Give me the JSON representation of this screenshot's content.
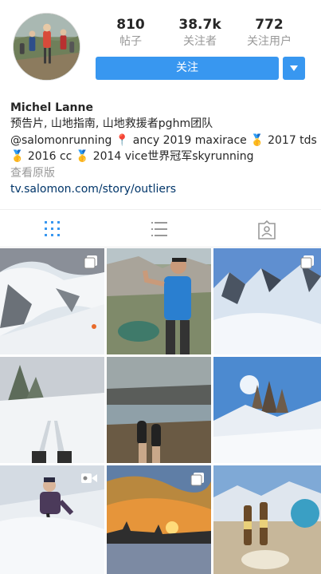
{
  "profile": {
    "username": "Michel Lanne",
    "avatar_icon": "profile-photo-trail-runners",
    "stats": [
      {
        "value": "810",
        "label": "帖子"
      },
      {
        "value": "38.7k",
        "label": "关注者"
      },
      {
        "value": "772",
        "label": "关注用户"
      }
    ],
    "follow_label": "关注",
    "dropdown_icon": "triangle-down-icon",
    "bio_lines": [
      "预告片, 山地指南, 山地救援者pghm团队",
      "@salomonrunning 📍 ancy 2019 maxirace 🥇 2017 tds",
      "🥇 2016 cc 🥇 2014 vice世界冠军skyrunning"
    ],
    "translate_label": "查看原版",
    "website": "tv.salomon.com/story/outliers"
  },
  "tabs": [
    {
      "name": "grid-view",
      "icon": "grid-icon",
      "active": true
    },
    {
      "name": "list-view",
      "icon": "list-icon",
      "active": false
    },
    {
      "name": "tagged",
      "icon": "tagged-person-icon",
      "active": false
    }
  ],
  "posts": [
    {
      "subject": "snowy-ridge-climber",
      "badge": "carousel-icon"
    },
    {
      "subject": "runner-by-alpine-lake",
      "badge": ""
    },
    {
      "subject": "snowy-peaks-blue-sky",
      "badge": "carousel-icon"
    },
    {
      "subject": "skis-in-snow",
      "badge": ""
    },
    {
      "subject": "feet-over-lake-view",
      "badge": ""
    },
    {
      "subject": "dolomite-peaks-sunburst",
      "badge": ""
    },
    {
      "subject": "skier-selfie",
      "badge": "video-icon"
    },
    {
      "subject": "orange-sunset-clouds",
      "badge": "carousel-icon"
    },
    {
      "subject": "beers-on-summit",
      "badge": ""
    }
  ],
  "colors": {
    "accent": "#3897f0",
    "text": "#262626",
    "muted": "#999999",
    "link": "#003569"
  }
}
